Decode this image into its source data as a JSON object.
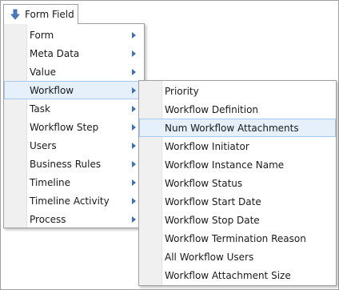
{
  "button": {
    "label": "Form Field",
    "icon": "down-arrow-icon"
  },
  "menu": {
    "items": [
      {
        "label": "Form",
        "has_submenu": true
      },
      {
        "label": "Meta Data",
        "has_submenu": true
      },
      {
        "label": "Value",
        "has_submenu": true
      },
      {
        "label": "Workflow",
        "has_submenu": true,
        "active": true
      },
      {
        "label": "Task",
        "has_submenu": true
      },
      {
        "label": "Workflow Step",
        "has_submenu": true
      },
      {
        "label": "Users",
        "has_submenu": true
      },
      {
        "label": "Business Rules",
        "has_submenu": true
      },
      {
        "label": "Timeline",
        "has_submenu": true
      },
      {
        "label": "Timeline Activity",
        "has_submenu": true
      },
      {
        "label": "Process",
        "has_submenu": true
      }
    ]
  },
  "submenu": {
    "items": [
      {
        "label": "Priority"
      },
      {
        "label": "Workflow Definition"
      },
      {
        "label": "Num Workflow Attachments",
        "active": true
      },
      {
        "label": "Workflow Initiator"
      },
      {
        "label": "Workflow Instance Name"
      },
      {
        "label": "Workflow Status"
      },
      {
        "label": "Workflow Start Date"
      },
      {
        "label": "Workflow Stop Date"
      },
      {
        "label": "Workflow Termination Reason"
      },
      {
        "label": "All Workflow Users"
      },
      {
        "label": "Workflow Attachment Size"
      }
    ]
  },
  "colors": {
    "highlight_bg": "#e5f0fb",
    "highlight_border": "#a8c9ee",
    "chevron": "#3e6fb0",
    "arrow_icon": "#4a7cc0"
  }
}
